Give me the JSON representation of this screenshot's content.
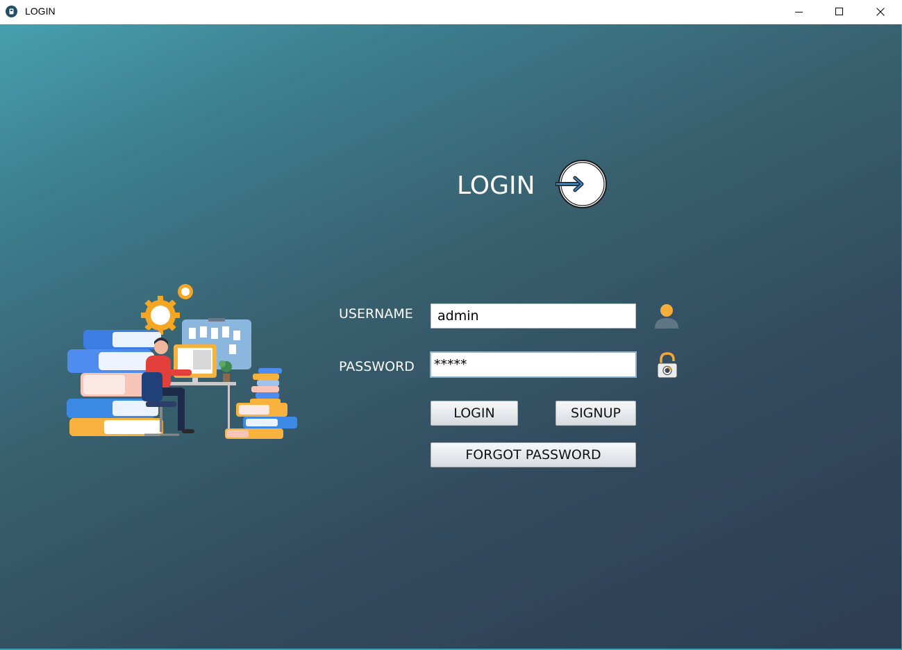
{
  "window": {
    "title": "LOGIN",
    "controls": {
      "minimize": "minimize-icon",
      "maximize": "maximize-icon",
      "close": "close-icon"
    }
  },
  "heading": {
    "title": "LOGIN",
    "icon": "login-arrow-circle-icon"
  },
  "form": {
    "username": {
      "label": "USERNAME",
      "value": "admin",
      "icon": "user-icon"
    },
    "password": {
      "label": "PASSWORD",
      "value": "*****",
      "icon": "lock-icon"
    }
  },
  "buttons": {
    "login": "LOGIN",
    "signup": "SIGNUP",
    "forgot_password": "FORGOT PASSWORD"
  },
  "illustration": {
    "icon": "person-at-desk-with-books-illustration"
  },
  "colors": {
    "background_start": "#46a0ad",
    "background_end": "#2d3d52",
    "text": "#ffffff",
    "user_icon_head": "#f5ad3c",
    "user_icon_body": "#5e7585"
  }
}
